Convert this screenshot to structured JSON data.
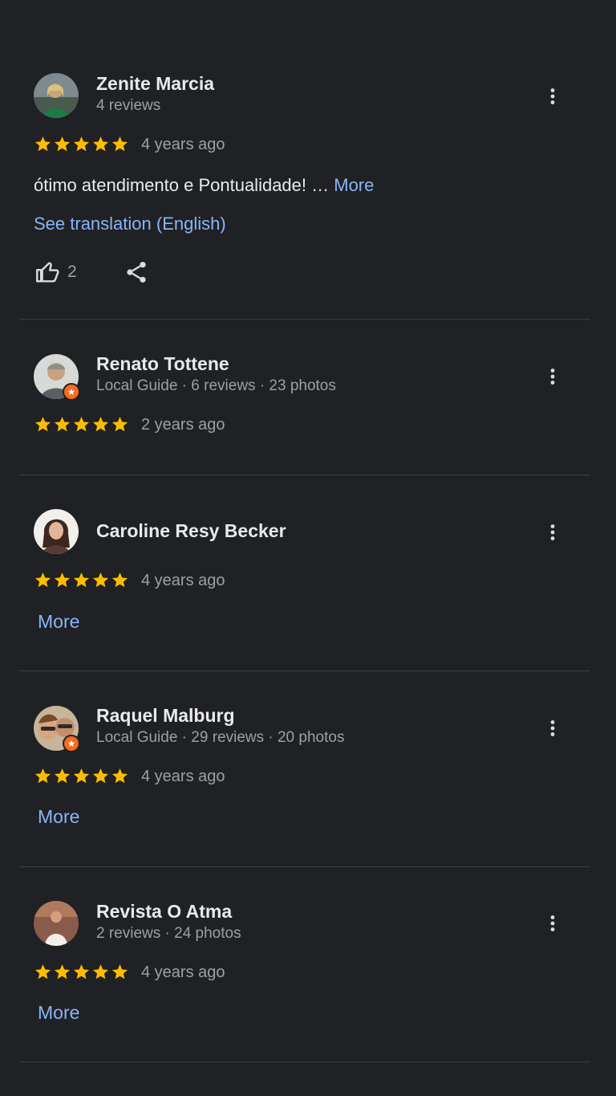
{
  "colors": {
    "background": "#202124",
    "star": "#fbbc04",
    "link": "#8ab4f8",
    "text_primary": "#e8eaed",
    "text_secondary": "#9aa0a6",
    "local_guide_badge": "#f76b1c"
  },
  "icons": {
    "star": "star-icon",
    "menu": "more-vert-icon",
    "like": "thumb-up-icon",
    "share": "share-icon",
    "local_guide": "local-guide-badge-icon"
  },
  "reviews": [
    {
      "name": "Zenite Marcia",
      "meta": "4 reviews",
      "rating": 5,
      "age": "4 years ago",
      "text": "ótimo atendimento e Pontualidade! …",
      "more_label": "More",
      "translation_label": "See translation (English)",
      "likes": "2"
    },
    {
      "name": "Renato Tottene",
      "meta": "Local Guide · 6 reviews · 23 photos",
      "rating": 5,
      "age": "2 years ago"
    },
    {
      "name": "Caroline Resy Becker",
      "rating": 5,
      "age": "4 years ago",
      "more_label": "More"
    },
    {
      "name": "Raquel Malburg",
      "meta": "Local Guide · 29 reviews · 20 photos",
      "rating": 5,
      "age": "4 years ago",
      "more_label": "More"
    },
    {
      "name": "Revista O Atma",
      "meta": "2 reviews · 24 photos",
      "rating": 5,
      "age": "4 years ago",
      "more_label": "More"
    }
  ]
}
